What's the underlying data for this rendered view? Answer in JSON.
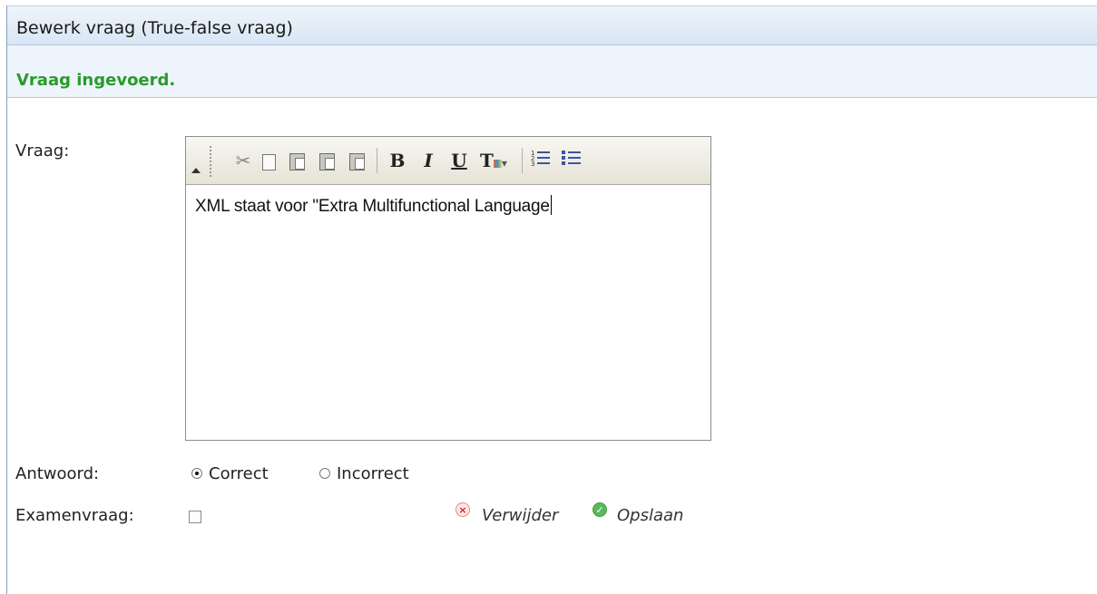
{
  "window": {
    "title": "Bewerk vraag (True-false vraag)"
  },
  "status": {
    "message": "Vraag ingevoerd.",
    "color": "#2a9a2a"
  },
  "form": {
    "question_label": "Vraag:",
    "answer_label": "Antwoord:",
    "exam_label": "Examenvraag:",
    "editor_content": "XML staat voor \"Extra Multifunctional Language",
    "answer_options": [
      {
        "label": "Correct",
        "selected": true
      },
      {
        "label": "Incorrect",
        "selected": false
      }
    ],
    "exam_checked": false
  },
  "toolbar": {
    "buttons": [
      "collapse-icon",
      "cut-icon",
      "copy-icon",
      "paste-icon",
      "paste-text-icon",
      "paste-word-icon",
      "bold-icon",
      "italic-icon",
      "underline-icon",
      "font-color-icon",
      "ordered-list-icon",
      "unordered-list-icon"
    ],
    "bold_glyph": "B",
    "italic_glyph": "I",
    "underline_glyph": "U",
    "color_glyph": "T",
    "cut_glyph": "✂",
    "dropdown_glyph": "▾"
  },
  "actions": {
    "delete_label": "Verwijder",
    "save_label": "Opslaan",
    "delete_glyph": "×",
    "save_glyph": "✓"
  }
}
